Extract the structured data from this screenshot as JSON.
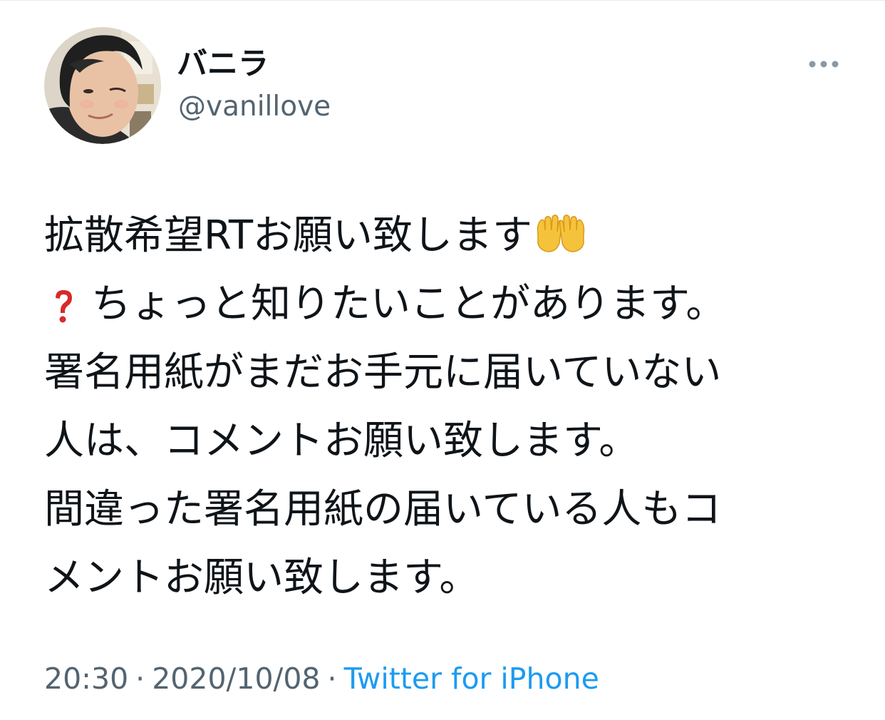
{
  "tweet": {
    "author": {
      "display_name": "バニラ",
      "handle": "@vanillove"
    },
    "more_icon": "more-horizontal-icon",
    "text_lines": [
      "拡散希望RTお願い致します",
      "ちょっと知りたいことがあります。",
      "署名用紙がまだお手元に届いていない",
      "人は、コメントお願い致します。",
      "間違った署名用紙の届いている人もコ",
      "メントお願い致します。"
    ],
    "emojis": {
      "raising_hands": "palms-up-together-emoji",
      "question_mark": "red-question-mark-emoji"
    },
    "time": "20:30",
    "date": "2020/10/08",
    "separator": "·",
    "source": "Twitter for iPhone"
  },
  "colors": {
    "text": "#0f1419",
    "secondary": "#536471",
    "link": "#1d9bf0",
    "divider": "#e6ecf0",
    "question_mark": "#d82a2a",
    "hands_emoji": "#f5c33b"
  }
}
